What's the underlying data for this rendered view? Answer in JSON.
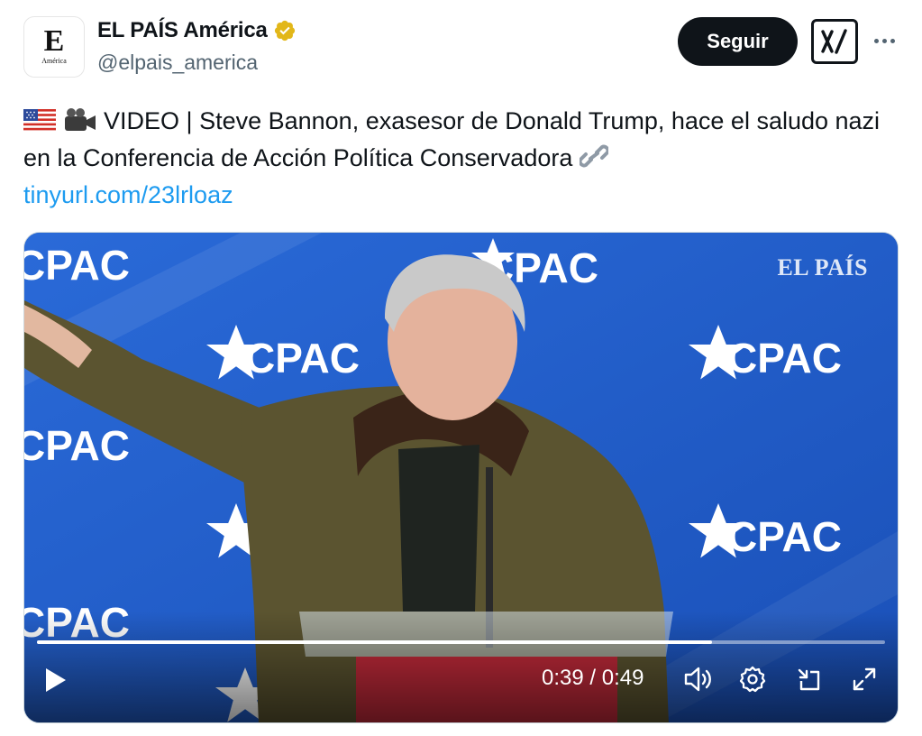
{
  "account": {
    "display_name": "EL PAÍS América",
    "handle": "@elpais_america",
    "avatar_letter": "E",
    "avatar_subtext": "América",
    "verified_color": "#e2b719"
  },
  "header": {
    "follow_label": "Seguir"
  },
  "tweet": {
    "text_line": "VIDEO | Steve Bannon, exasesor de Donald Trump, hace el saludo nazi en la Conferencia de Acción Política Conservadora",
    "link": "tinyurl.com/23lrloaz",
    "emojis": [
      "us-flag-emoji",
      "video-camera-emoji",
      "link-emoji"
    ]
  },
  "video": {
    "watermark": "EL PAÍS",
    "backdrop_text": "CPAC",
    "current_time": "0:39",
    "separator": "/",
    "duration": "0:49",
    "progress_fraction": 0.796,
    "colors": {
      "backdrop": "#1d5cc8",
      "jacket": "#5b5430"
    }
  },
  "colors": {
    "accent_link": "#1d9bf0",
    "button_dark": "#0f1419",
    "secondary_text": "#536471"
  }
}
